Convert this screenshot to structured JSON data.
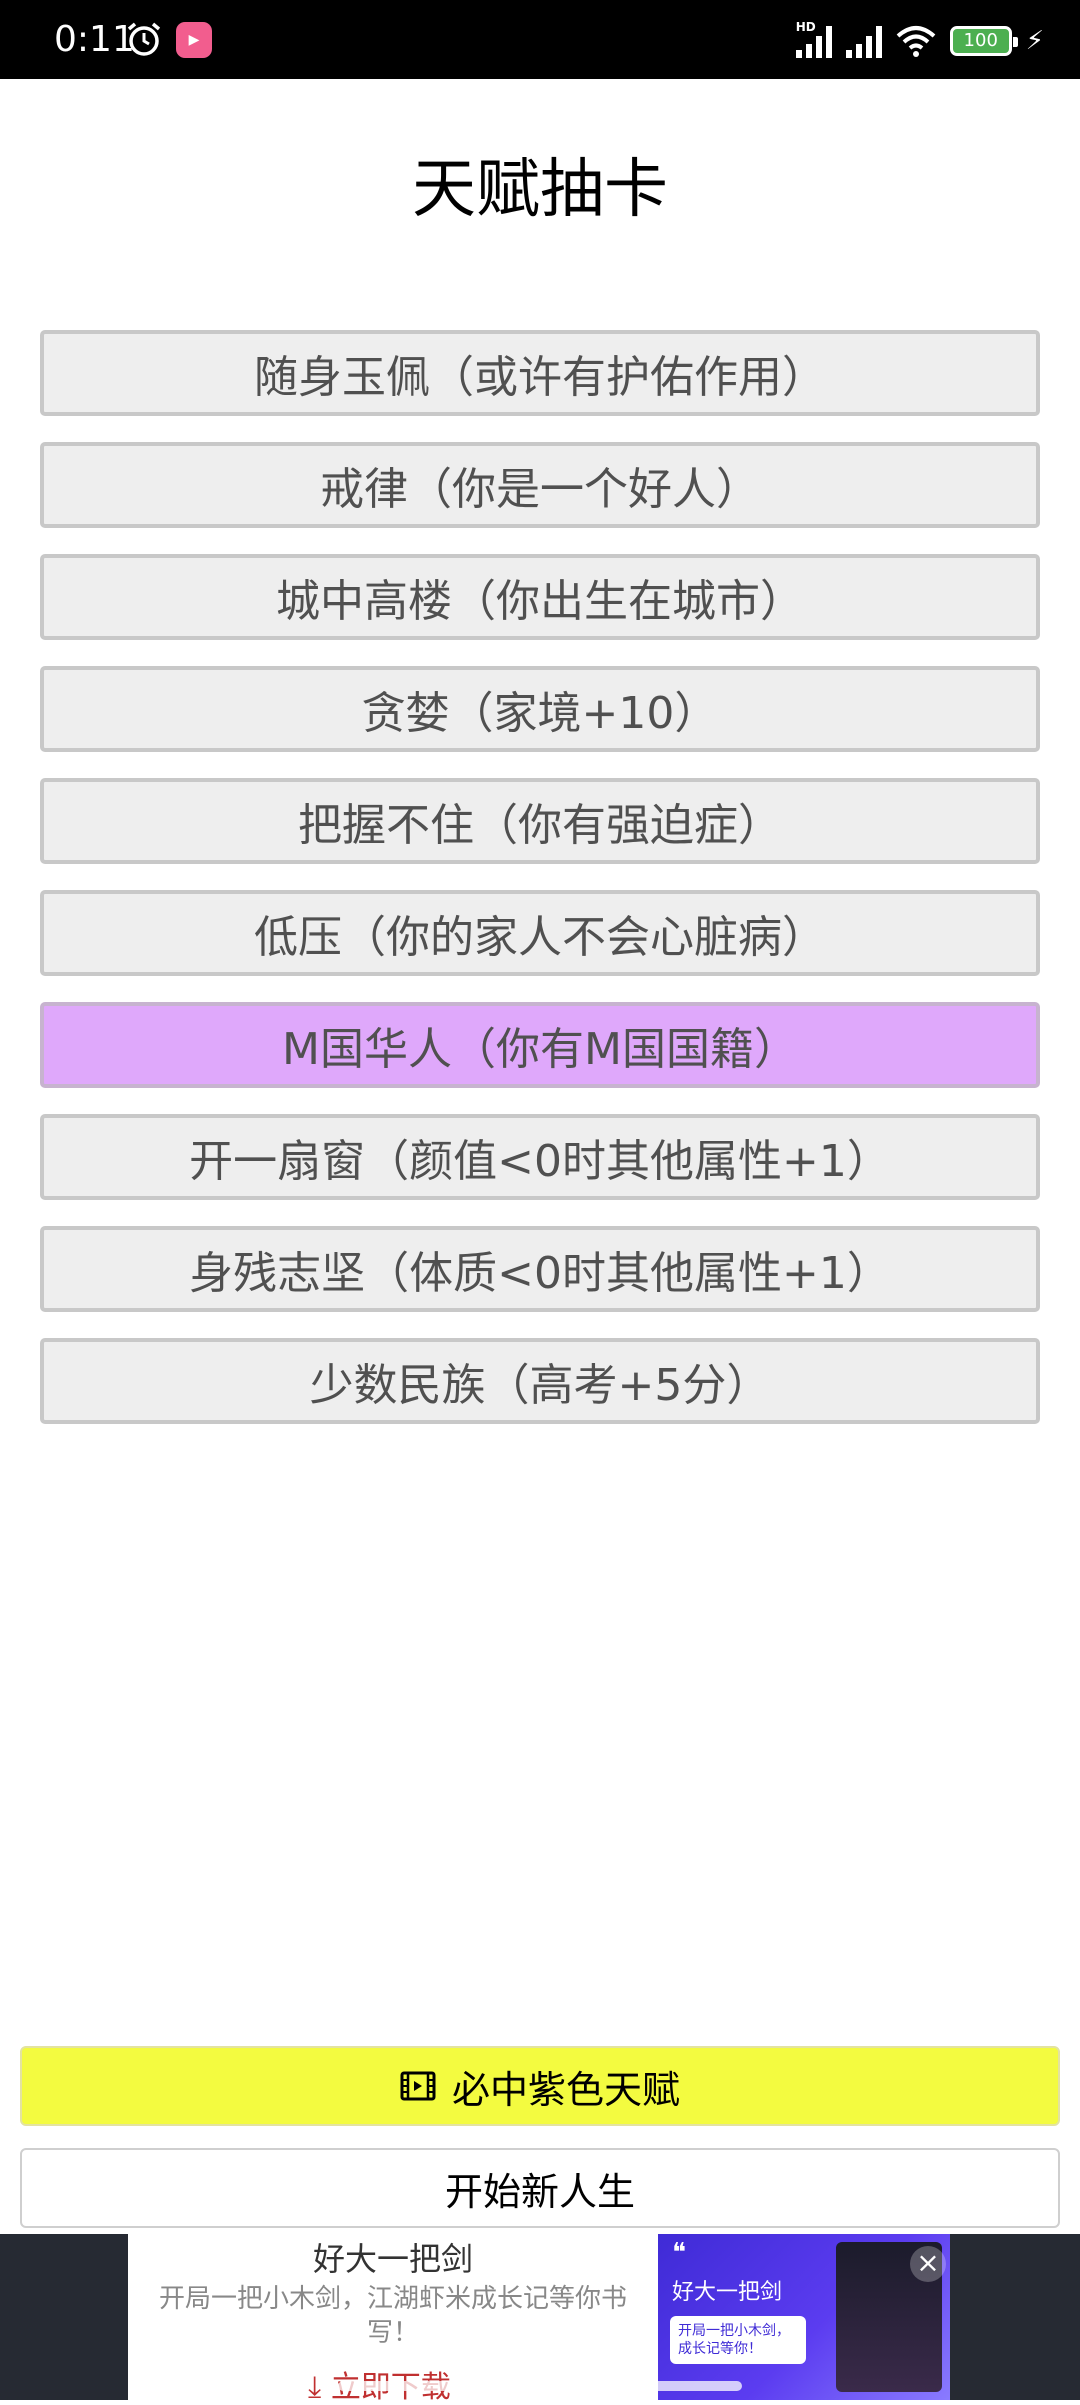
{
  "status_bar": {
    "time": "0:11",
    "battery": "100",
    "hd_label": "HD"
  },
  "page": {
    "title": "天赋抽卡"
  },
  "talents": [
    {
      "label": "随身玉佩（或许有护佑作用）",
      "selected": false
    },
    {
      "label": "戒律（你是一个好人）",
      "selected": false
    },
    {
      "label": "城中高楼（你出生在城市）",
      "selected": false
    },
    {
      "label": "贪婪（家境+10）",
      "selected": false
    },
    {
      "label": "把握不住（你有强迫症）",
      "selected": false
    },
    {
      "label": "低压（你的家人不会心脏病）",
      "selected": false
    },
    {
      "label": "M国华人（你有M国国籍）",
      "selected": true
    },
    {
      "label": "开一扇窗（颜值<0时其他属性+1）",
      "selected": false
    },
    {
      "label": "身残志坚（体质<0时其他属性+1）",
      "selected": false
    },
    {
      "label": "少数民族（高考+5分）",
      "selected": false
    }
  ],
  "buttons": {
    "guaranteed_purple": "必中紫色天赋",
    "new_life": "开始新人生"
  },
  "ad": {
    "title": "好大一把剑",
    "description": "开局一把小木剑，江湖虾米成长记等你书写！",
    "download": "立即下载",
    "image_title": "好大一把剑",
    "image_caption": "开局一把小木剑，成长记等你！"
  },
  "colors": {
    "selected_talent": "#dfa8fb",
    "talent_bg": "#eeeeee",
    "purple_button": "#f3fb40"
  }
}
